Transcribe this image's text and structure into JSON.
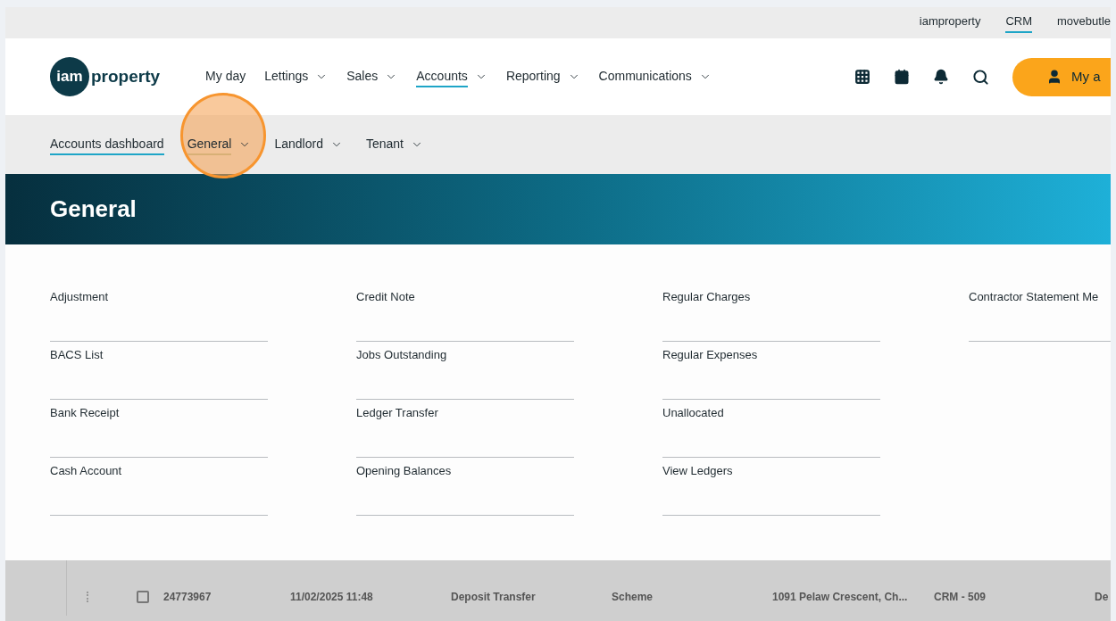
{
  "top_links": [
    {
      "label": "iamproperty",
      "selected": false
    },
    {
      "label": "CRM",
      "selected": true
    },
    {
      "label": "movebutle",
      "selected": false
    }
  ],
  "logo": {
    "mark": "iam",
    "word": "property"
  },
  "nav": [
    {
      "label": "My day",
      "dropdown": false,
      "selected": false
    },
    {
      "label": "Lettings",
      "dropdown": true,
      "selected": false
    },
    {
      "label": "Sales",
      "dropdown": true,
      "selected": false
    },
    {
      "label": "Accounts",
      "dropdown": true,
      "selected": true
    },
    {
      "label": "Reporting",
      "dropdown": true,
      "selected": false
    },
    {
      "label": "Communications",
      "dropdown": true,
      "selected": false
    }
  ],
  "account_button": "My a",
  "subnav": [
    {
      "label": "Accounts dashboard",
      "dropdown": false,
      "selected": true,
      "highlighted": false
    },
    {
      "label": "General",
      "dropdown": true,
      "selected": true,
      "highlighted": true
    },
    {
      "label": "Landlord",
      "dropdown": true,
      "selected": false,
      "highlighted": false
    },
    {
      "label": "Tenant",
      "dropdown": true,
      "selected": false,
      "highlighted": false
    }
  ],
  "banner_title": "General",
  "menu_columns": [
    [
      "Adjustment",
      "BACS List",
      "Bank Receipt",
      "Cash Account"
    ],
    [
      "Credit Note",
      "Jobs Outstanding",
      "Ledger Transfer",
      "Opening Balances"
    ],
    [
      "Regular Charges",
      "Regular Expenses",
      "Unallocated",
      "View Ledgers"
    ],
    [
      "Contractor Statement Me"
    ]
  ],
  "table_rows": [
    {
      "id": "24773967",
      "date": "11/02/2025 11:48",
      "type": "Deposit Transfer",
      "category": "Scheme",
      "address": "1091 Pelaw Crescent, Ch...",
      "ref": "CRM - 509",
      "column_7": "De",
      "checked": false
    }
  ]
}
